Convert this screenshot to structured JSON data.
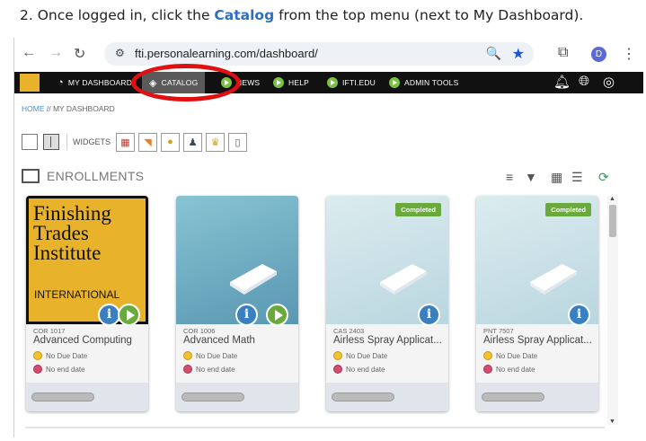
{
  "instruction": {
    "prefix": "2.  Once logged in, click the ",
    "highlight": "Catalog",
    "suffix": " from the top menu (next to My Dashboard)."
  },
  "browser": {
    "url": "fti.personalearning.com/dashboard/",
    "profile_initial": "D"
  },
  "site_nav": {
    "items": [
      {
        "label": "MY DASHBOARD",
        "icon": "dashboard-icon"
      },
      {
        "label": "CATALOG",
        "icon": "layers-icon"
      },
      {
        "label": "NEWS",
        "icon": "play-icon"
      },
      {
        "label": "HELP",
        "icon": "play-icon"
      },
      {
        "label": "IFTI.EDU",
        "icon": "play-icon"
      },
      {
        "label": "ADMIN TOOLS",
        "icon": "play-icon"
      }
    ]
  },
  "breadcrumb": {
    "home": "HOME",
    "sep": " // ",
    "current": "MY DASHBOARD"
  },
  "widgets_label": "WIDGETS",
  "section_title": "ENROLLMENTS",
  "cards": [
    {
      "code": "COR 1017",
      "name": "Advanced Computing",
      "due": "No Due Date",
      "end": "No end date",
      "thumb_line1": "Finishing",
      "thumb_line2": "Trades",
      "thumb_line3": "Institute",
      "thumb_sub": "INTERNATIONAL"
    },
    {
      "code": "COR 1006",
      "name": "Advanced Math",
      "due": "No Due Date",
      "end": "No end date"
    },
    {
      "code": "CAS 2403",
      "name": "Airless Spray Applicat...",
      "due": "No Due Date",
      "end": "No end date",
      "badge": "Completed"
    },
    {
      "code": "PNT 7507",
      "name": "Airless Spray Applicat...",
      "due": "No Due Date",
      "end": "No end date",
      "badge": "Completed"
    }
  ],
  "colors": {
    "accent_link": "#2f6fbd",
    "annotation": "#e01010",
    "nav_bg": "#111111",
    "completed": "#6aaa3c"
  }
}
